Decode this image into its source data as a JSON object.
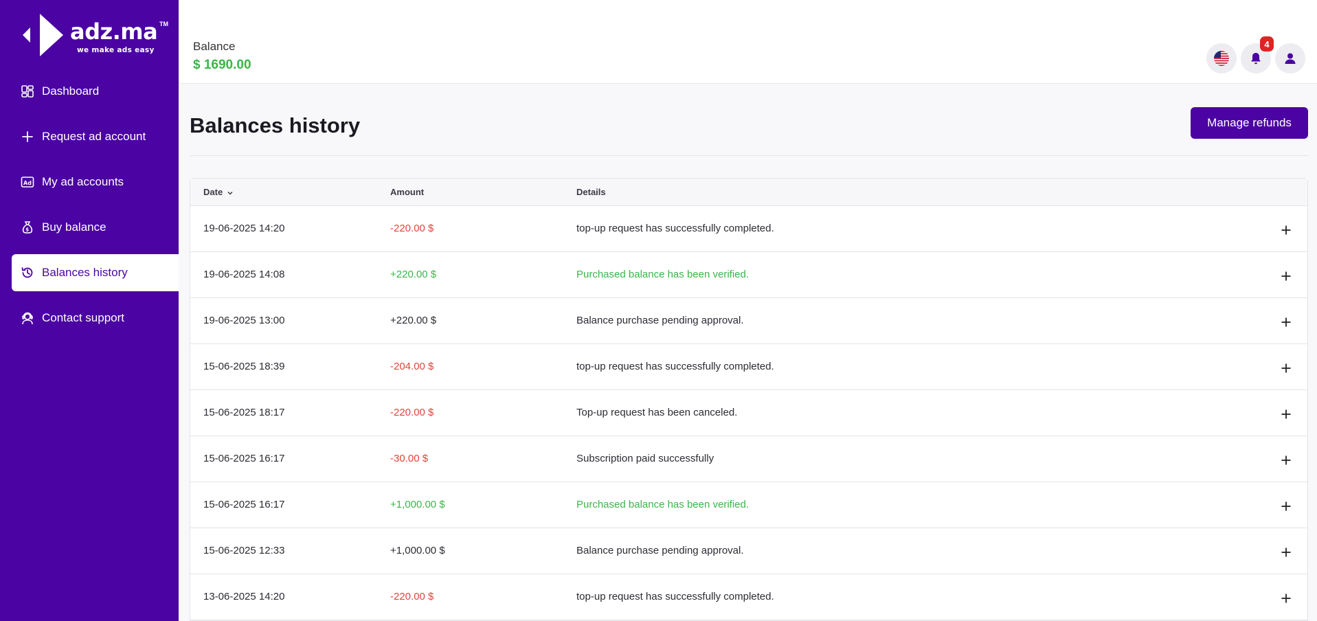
{
  "brand": {
    "name": "adz.ma",
    "tagline": "we make ads easy",
    "tm": "TM"
  },
  "sidebar": {
    "items": [
      {
        "label": "Dashboard",
        "icon": "dashboard-icon"
      },
      {
        "label": "Request ad account",
        "icon": "plus-icon"
      },
      {
        "label": "My ad accounts",
        "icon": "ad-icon"
      },
      {
        "label": "Buy balance",
        "icon": "money-bag-icon"
      },
      {
        "label": "Balances history",
        "icon": "history-icon",
        "active": true
      },
      {
        "label": "Contact support",
        "icon": "support-agent-icon"
      }
    ]
  },
  "header": {
    "balance_label": "Balance",
    "balance_value": "$ 1690.00",
    "notification_count": "4"
  },
  "page": {
    "title": "Balances history",
    "manage_refunds_label": "Manage refunds"
  },
  "table": {
    "columns": {
      "date": "Date",
      "amount": "Amount",
      "details": "Details"
    },
    "rows": [
      {
        "date": "19-06-2025 14:20",
        "amount": "-220.00 $",
        "details": "top-up request has successfully completed."
      },
      {
        "date": "19-06-2025 14:08",
        "amount": "+220.00 $",
        "details": "Purchased balance has been verified."
      },
      {
        "date": "19-06-2025 13:00",
        "amount": "+220.00 $",
        "details": "Balance purchase pending approval."
      },
      {
        "date": "15-06-2025 18:39",
        "amount": "-204.00 $",
        "details": "top-up request has successfully completed."
      },
      {
        "date": "15-06-2025 18:17",
        "amount": "-220.00 $",
        "details": "Top-up request has been canceled."
      },
      {
        "date": "15-06-2025 16:17",
        "amount": "-30.00 $",
        "details": "Subscription paid successfully"
      },
      {
        "date": "15-06-2025 16:17",
        "amount": "+1,000.00 $",
        "details": "Purchased balance has been verified."
      },
      {
        "date": "15-06-2025 12:33",
        "amount": "+1,000.00 $",
        "details": "Balance purchase pending approval."
      },
      {
        "date": "13-06-2025 14:20",
        "amount": "-220.00 $",
        "details": "top-up request has successfully completed."
      }
    ]
  },
  "colors": {
    "brand": "#4b03a3",
    "positive": "#3bb54a",
    "negative": "#e0443a",
    "badge": "#e02424"
  }
}
